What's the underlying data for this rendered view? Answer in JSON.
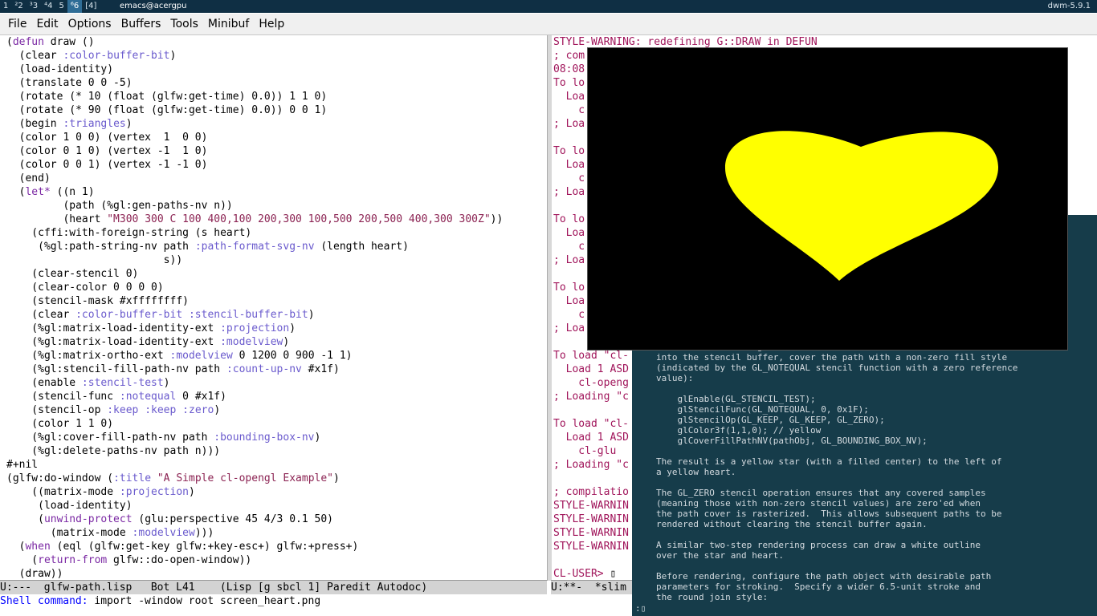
{
  "dwm": {
    "tags": [
      "1",
      "²2",
      "³3",
      "⁴4",
      "5",
      "⁶6",
      "[4]"
    ],
    "selected_tag_index": 5,
    "window_title": "emacs@acergpu",
    "status": "dwm-5.9.1"
  },
  "menu": [
    "File",
    "Edit",
    "Options",
    "Buffers",
    "Tools",
    "Minibuf",
    "Help"
  ],
  "editor": {
    "code_lines": [
      "(defun draw ()",
      "  (clear :color-buffer-bit)",
      "  (load-identity)",
      "  (translate 0 0 -5)",
      "  (rotate (* 10 (float (glfw:get-time) 0.0)) 1 1 0)",
      "  (rotate (* 90 (float (glfw:get-time) 0.0)) 0 0 1)",
      "  (begin :triangles)",
      "  (color 1 0 0) (vertex  1  0 0)",
      "  (color 0 1 0) (vertex -1  1 0)",
      "  (color 0 0 1) (vertex -1 -1 0)",
      "  (end)",
      "  (let* ((n 1)",
      "         (path (%gl:gen-paths-nv n))",
      "         (heart \"M300 300 C 100 400,100 200,300 100,500 200,500 400,300 300Z\"))",
      "    (cffi:with-foreign-string (s heart)",
      "     (%gl:path-string-nv path :path-format-svg-nv (length heart)",
      "                         s))",
      "    (clear-stencil 0)",
      "    (clear-color 0 0 0 0)",
      "    (stencil-mask #xffffffff)",
      "    (clear :color-buffer-bit :stencil-buffer-bit)",
      "    (%gl:matrix-load-identity-ext :projection)",
      "    (%gl:matrix-load-identity-ext :modelview)",
      "    (%gl:matrix-ortho-ext :modelview 0 1200 0 900 -1 1)",
      "    (%gl:stencil-fill-path-nv path :count-up-nv #x1f)",
      "    (enable :stencil-test)",
      "    (stencil-func :notequal 0 #x1f)",
      "    (stencil-op :keep :keep :zero)",
      "    (color 1 1 0)",
      "    (%gl:cover-fill-path-nv path :bounding-box-nv)",
      "    (%gl:delete-paths-nv path n)))",
      "#+nil",
      "(glfw:do-window (:title \"A Simple cl-opengl Example\")",
      "    ((matrix-mode :projection)",
      "     (load-identity)",
      "     (unwind-protect (glu:perspective 45 4/3 0.1 50)",
      "       (matrix-mode :modelview)))",
      "  (when (eql (glfw:get-key glfw:+key-esc+) glfw:+press+)",
      "    (return-from glfw::do-open-window))",
      "  (draw))"
    ],
    "modeline": "U:---  glfw-path.lisp   Bot L41    (Lisp [g sbcl 1] Paredit Autodoc)"
  },
  "repl": {
    "lines": [
      "STYLE-WARNING: redefining G::DRAW in DEFUN",
      "; com                                                     012",
      "08:08",
      "To lo",
      "  Loa",
      "    c",
      "; Loa",
      "",
      "To lo",
      "  Loa",
      "    c",
      "; Loa",
      "",
      "To lo",
      "  Loa",
      "    c",
      "; Loa",
      "",
      "To lo",
      "  Loa",
      "    c",
      "; Loa",
      "",
      "To load \"cl-",
      "  Load 1 ASD",
      "    cl-openg",
      "; Loading \"c",
      "",
      "To load \"cl-",
      "  Load 1 ASD",
      "    cl-glu",
      "; Loading \"c",
      "",
      "; compilatio",
      "STYLE-WARNIN",
      "STYLE-WARNIN",
      "STYLE-WARNIN",
      "STYLE-WARNIN",
      "",
      "CL-USER> "
    ],
    "modeline": "U:**-  *slim"
  },
  "minibuffer": {
    "prompt": "Shell command:",
    "value": " import -window root screen_heart.png"
  },
  "terminal": {
    "text": "Now that the coverage of the star and the heart have been rasterized\ninto the stencil buffer, cover the path with a non-zero fill style\n(indicated by the GL_NOTEQUAL stencil function with a zero reference\nvalue):\n\n    glEnable(GL_STENCIL_TEST);\n    glStencilFunc(GL_NOTEQUAL, 0, 0x1F);\n    glStencilOp(GL_KEEP, GL_KEEP, GL_ZERO);\n    glColor3f(1,1,0); // yellow\n    glCoverFillPathNV(pathObj, GL_BOUNDING_BOX_NV);\n\nThe result is a yellow star (with a filled center) to the left of\na yellow heart.\n\nThe GL_ZERO stencil operation ensures that any covered samples\n(meaning those with non-zero stencil values) are zero'ed when\nthe path cover is rasterized.  This allows subsequent paths to be\nrendered without clearing the stencil buffer again.\n\nA similar two-step rendering process can draw a white outline\nover the star and heart.\n\nBefore rendering, configure the path object with desirable path\nparameters for stroking.  Specify a wider 6.5-unit stroke and\nthe round join style:",
    "prompt": ":"
  },
  "colors": {
    "heart": "#ffff00",
    "gl_background": "#000000",
    "terminal_background": "#163c4a"
  }
}
